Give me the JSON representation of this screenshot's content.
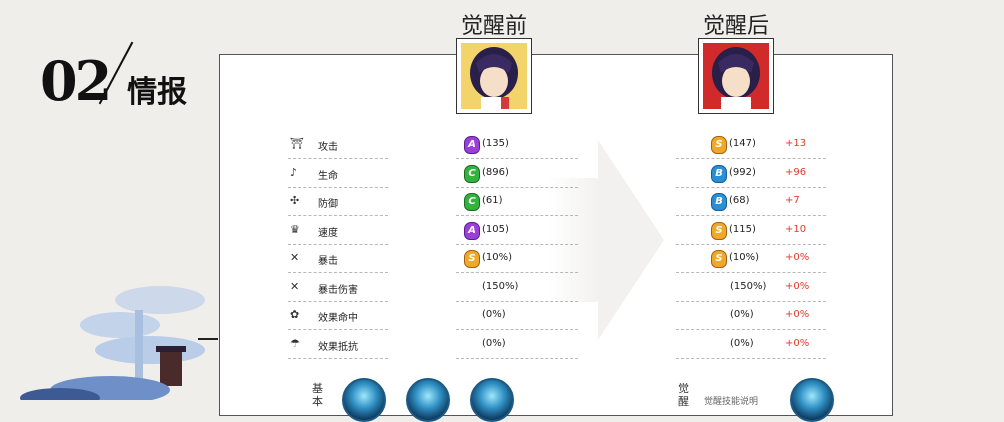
{
  "header": {
    "number": "02",
    "title": "情报"
  },
  "columns": {
    "before": {
      "title": "觉醒前"
    },
    "after": {
      "title": "觉醒后"
    }
  },
  "stats": [
    {
      "label": "攻击",
      "icon": "torii-icon",
      "before_grade": "A",
      "before_value": "(135)",
      "after_grade": "S",
      "after_value": "(147)",
      "delta": "+13"
    },
    {
      "label": "生命",
      "icon": "health-icon",
      "before_grade": "C",
      "before_value": "(896)",
      "after_grade": "B",
      "after_value": "(992)",
      "delta": "+96"
    },
    {
      "label": "防御",
      "icon": "shield-shuriken-icon",
      "before_grade": "C",
      "before_value": "(61)",
      "after_grade": "B",
      "after_value": "(68)",
      "delta": "+7"
    },
    {
      "label": "速度",
      "icon": "speed-icon",
      "before_grade": "A",
      "before_value": "(105)",
      "after_grade": "S",
      "after_value": "(115)",
      "delta": "+10"
    },
    {
      "label": "暴击",
      "icon": "crossed-swords-icon",
      "before_grade": "S",
      "before_value": "(10%)",
      "after_grade": "S",
      "after_value": "(10%)",
      "delta": "+0%"
    },
    {
      "label": "暴击伤害",
      "icon": "crossed-swords-icon",
      "before_grade": "",
      "before_value": "(150%)",
      "after_grade": "",
      "after_value": "(150%)",
      "delta": "+0%"
    },
    {
      "label": "效果命中",
      "icon": "flower-icon",
      "before_grade": "",
      "before_value": "(0%)",
      "after_grade": "",
      "after_value": "(0%)",
      "delta": "+0%"
    },
    {
      "label": "效果抵抗",
      "icon": "umbrella-icon",
      "before_grade": "",
      "before_value": "(0%)",
      "after_grade": "",
      "after_value": "(0%)",
      "delta": "+0%"
    }
  ],
  "skills_before": {
    "label": "基本"
  },
  "skills_after": {
    "label": "觉醒",
    "partial_text": "觉醒技能说明"
  },
  "colors": {
    "delta": "#e03a2a",
    "grade_a": "#9b3fd9",
    "grade_b": "#2b8fd6",
    "grade_c": "#33b33d",
    "grade_s": "#f0a82a"
  }
}
